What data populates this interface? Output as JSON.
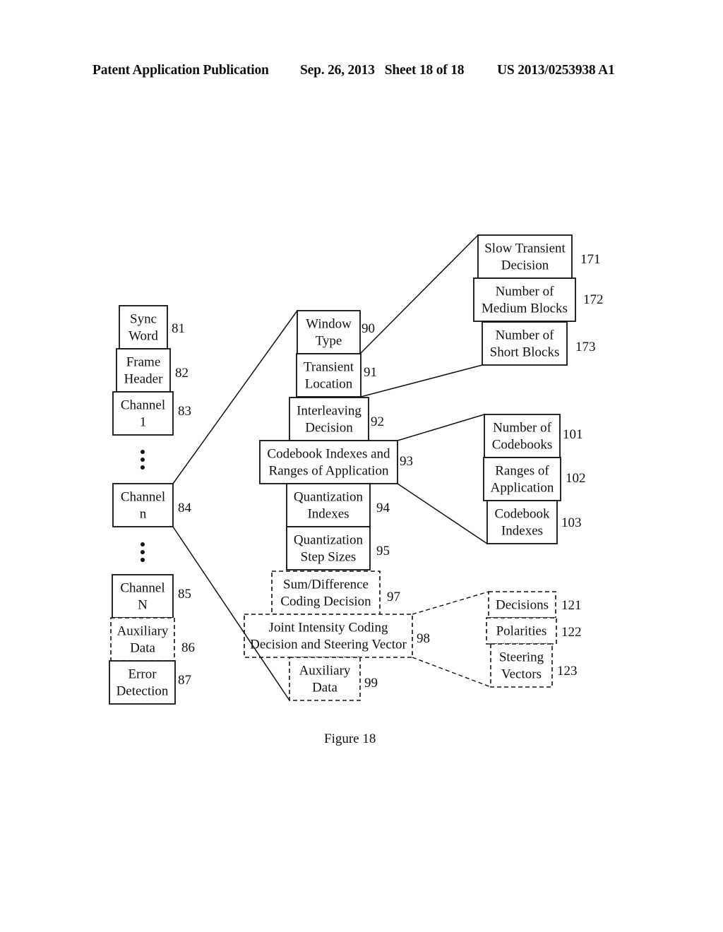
{
  "header": {
    "publication": "Patent Application Publication",
    "date_sheet": "Sep. 26, 2013   Sheet 18 of 18",
    "patent_number": "US 2013/0253938 A1"
  },
  "figure_caption": "Figure 18",
  "frame_stack": [
    {
      "id": "sync-word",
      "lines": [
        "Sync",
        "Word"
      ],
      "ref": "81",
      "style": "solid"
    },
    {
      "id": "frame-header",
      "lines": [
        "Frame",
        "Header"
      ],
      "ref": "82",
      "style": "solid"
    },
    {
      "id": "channel-1",
      "lines": [
        "Channel",
        "1"
      ],
      "ref": "83",
      "style": "solid"
    },
    {
      "id": "channel-n",
      "lines": [
        "Channel",
        "n"
      ],
      "ref": "84",
      "style": "solid"
    },
    {
      "id": "channel-N",
      "lines": [
        "Channel",
        "N"
      ],
      "ref": "85",
      "style": "solid"
    },
    {
      "id": "auxiliary-data",
      "lines": [
        "Auxiliary",
        "Data"
      ],
      "ref": "86",
      "style": "dashed"
    },
    {
      "id": "error-detection",
      "lines": [
        "Error",
        "Detection"
      ],
      "ref": "87",
      "style": "solid"
    }
  ],
  "channel_stack": [
    {
      "id": "window-type",
      "lines": [
        "Window",
        "Type"
      ],
      "ref": "90",
      "style": "solid"
    },
    {
      "id": "transient-location",
      "lines": [
        "Transient",
        "Location"
      ],
      "ref": "91",
      "style": "solid"
    },
    {
      "id": "interleaving-decision",
      "lines": [
        "Interleaving",
        "Decision"
      ],
      "ref": "92",
      "style": "solid"
    },
    {
      "id": "codebook-indexes-ranges",
      "lines": [
        "Codebook Indexes and",
        "Ranges of Application"
      ],
      "ref": "93",
      "style": "solid"
    },
    {
      "id": "quantization-indexes",
      "lines": [
        "Quantization",
        "Indexes"
      ],
      "ref": "94",
      "style": "solid"
    },
    {
      "id": "quantization-step-sizes",
      "lines": [
        "Quantization",
        "Step Sizes"
      ],
      "ref": "95",
      "style": "solid"
    },
    {
      "id": "sum-difference-coding",
      "lines": [
        "Sum/Difference",
        "Coding Decision"
      ],
      "ref": "97",
      "style": "dashed"
    },
    {
      "id": "joint-intensity-coding",
      "lines": [
        "Joint Intensity Coding",
        "Decision and Steering Vector"
      ],
      "ref": "98",
      "style": "dashed"
    },
    {
      "id": "channel-auxiliary-data",
      "lines": [
        "Auxiliary",
        "Data"
      ],
      "ref": "99",
      "style": "dashed"
    }
  ],
  "transient_stack": [
    {
      "id": "slow-transient-decision",
      "lines": [
        "Slow Transient",
        "Decision"
      ],
      "ref": "171",
      "style": "solid"
    },
    {
      "id": "number-medium-blocks",
      "lines": [
        "Number of",
        "Medium Blocks"
      ],
      "ref": "172",
      "style": "solid"
    },
    {
      "id": "number-short-blocks",
      "lines": [
        "Number of",
        "Short Blocks"
      ],
      "ref": "173",
      "style": "solid"
    }
  ],
  "codebook_stack": [
    {
      "id": "number-of-codebooks",
      "lines": [
        "Number of",
        "Codebooks"
      ],
      "ref": "101",
      "style": "solid"
    },
    {
      "id": "ranges-of-application",
      "lines": [
        "Ranges of",
        "Application"
      ],
      "ref": "102",
      "style": "solid"
    },
    {
      "id": "codebook-indexes",
      "lines": [
        "Codebook",
        "Indexes"
      ],
      "ref": "103",
      "style": "solid"
    }
  ],
  "joint_stack": [
    {
      "id": "decisions",
      "lines": [
        "Decisions"
      ],
      "ref": "121",
      "style": "dashed"
    },
    {
      "id": "polarities",
      "lines": [
        "Polarities"
      ],
      "ref": "122",
      "style": "dashed"
    },
    {
      "id": "steering-vectors",
      "lines": [
        "Steering",
        "Vectors"
      ],
      "ref": "123",
      "style": "dashed"
    }
  ]
}
